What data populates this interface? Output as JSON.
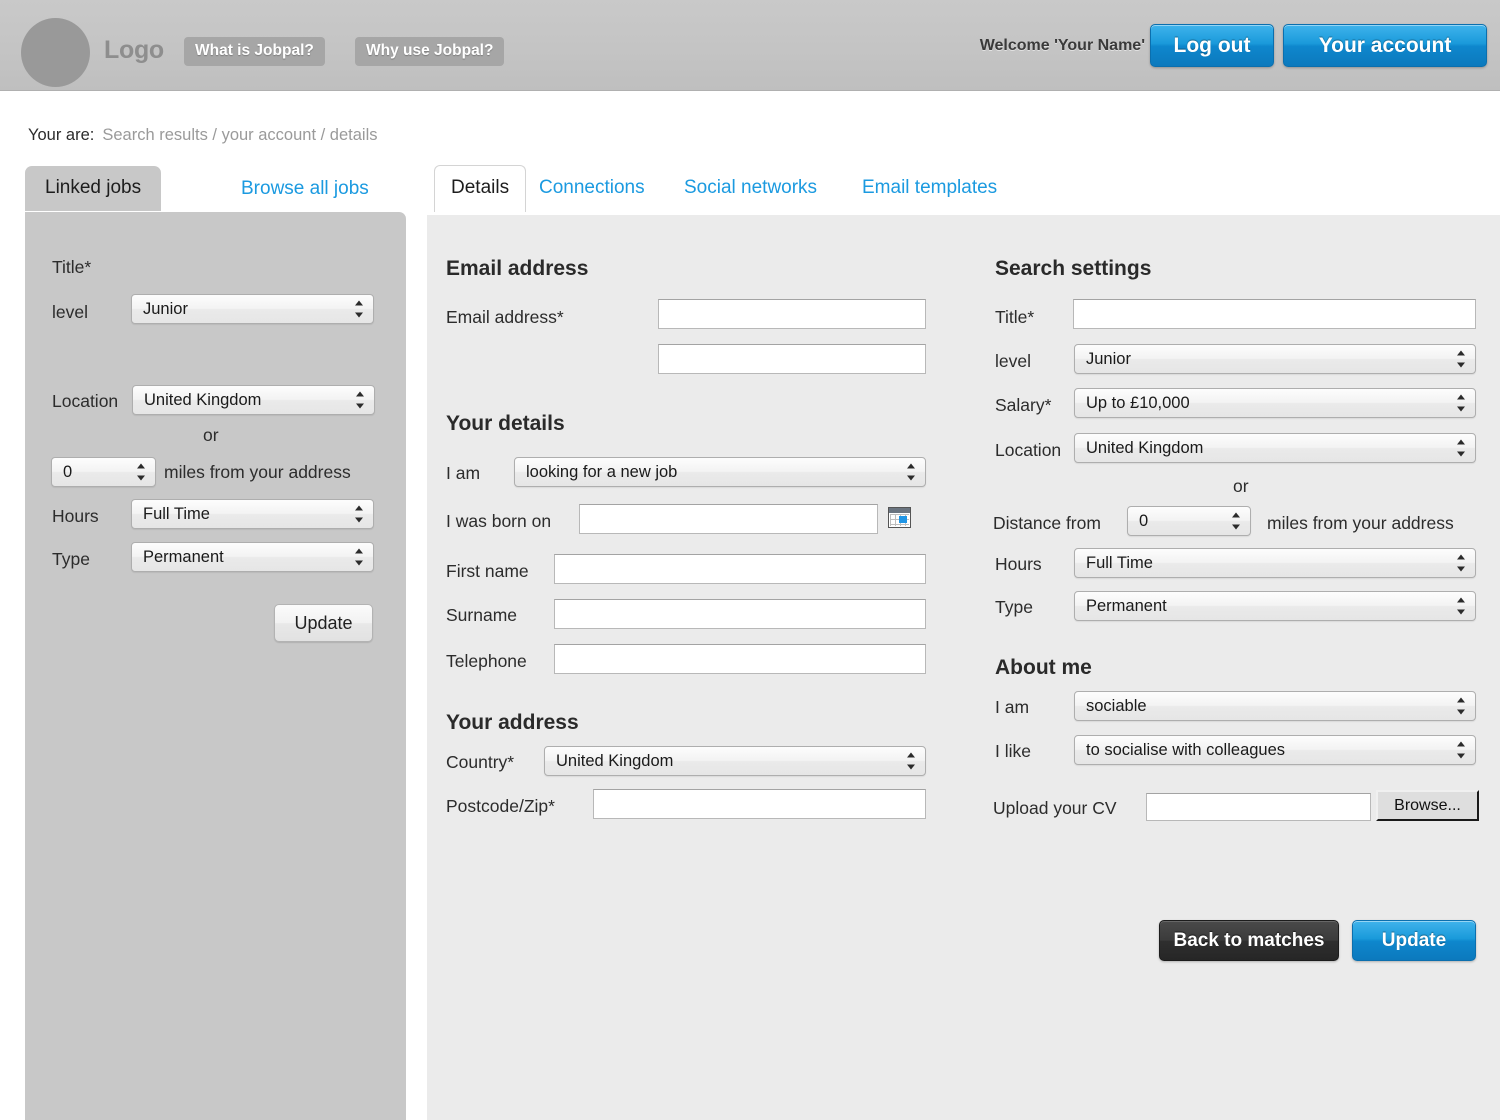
{
  "header": {
    "logo_text": "Logo",
    "nav": [
      {
        "label": "What is Jobpal?"
      },
      {
        "label": "Why use Jobpal?"
      }
    ],
    "welcome": "Welcome 'Your Name'",
    "logout_label": "Log out",
    "account_label": "Your account",
    "accent_blue": "#1a9ada",
    "header_bg": "#c4c4c4",
    "avatar_color": "#999999"
  },
  "breadcrumb": {
    "label": "Your are:",
    "path": "Search results / your account / details"
  },
  "left_panel": {
    "tabs": [
      {
        "label": "Linked jobs",
        "active": true
      },
      {
        "label": "Browse all jobs",
        "active": false
      }
    ],
    "title_label": "Title*",
    "level_label": "level",
    "level_value": "Junior",
    "location_label": "Location",
    "location_value": "United Kingdom",
    "or_label": "or",
    "distance_value": "0",
    "distance_suffix": "miles from your address",
    "hours_label": "Hours",
    "hours_value": "Full Time",
    "type_label": "Type",
    "type_value": "Permanent",
    "update_label": "Update"
  },
  "main": {
    "tabs": [
      {
        "label": "Details",
        "active": true
      },
      {
        "label": "Connections",
        "active": false
      },
      {
        "label": "Social networks",
        "active": false
      },
      {
        "label": "Email templates",
        "active": false
      }
    ],
    "email_section": {
      "heading": "Email address",
      "email_label": "Email address*",
      "email_value": "",
      "confirm_value": ""
    },
    "details_section": {
      "heading": "Your details",
      "i_am_label": "I am",
      "i_am_value": "looking for a new job",
      "born_label": "I was born on",
      "born_value": "",
      "calendar_icon": "calendar-icon",
      "first_name_label": "First name",
      "first_name_value": "",
      "surname_label": "Surname",
      "surname_value": "",
      "telephone_label": "Telephone",
      "telephone_value": ""
    },
    "address_section": {
      "heading": "Your address",
      "country_label": "Country*",
      "country_value": "United Kingdom",
      "postcode_label": "Postcode/Zip*",
      "postcode_value": ""
    },
    "search_settings": {
      "heading": "Search settings",
      "title_label": "Title*",
      "title_value": "",
      "level_label": "level",
      "level_value": "Junior",
      "salary_label": "Salary*",
      "salary_value": "Up to £10,000",
      "location_label": "Location",
      "location_value": "United Kingdom",
      "or_label": "or",
      "distance_label": "Distance from",
      "distance_value": "0",
      "distance_suffix": "miles from your address",
      "hours_label": "Hours",
      "hours_value": "Full Time",
      "type_label": "Type",
      "type_value": "Permanent"
    },
    "about_me": {
      "heading": "About me",
      "i_am_label": "I am",
      "i_am_value": "sociable",
      "i_like_label": "I like",
      "i_like_value": "to socialise with colleagues",
      "upload_label": "Upload your CV",
      "upload_value": "",
      "browse_label": "Browse..."
    },
    "actions": {
      "back_label": "Back to matches",
      "update_label": "Update"
    }
  }
}
